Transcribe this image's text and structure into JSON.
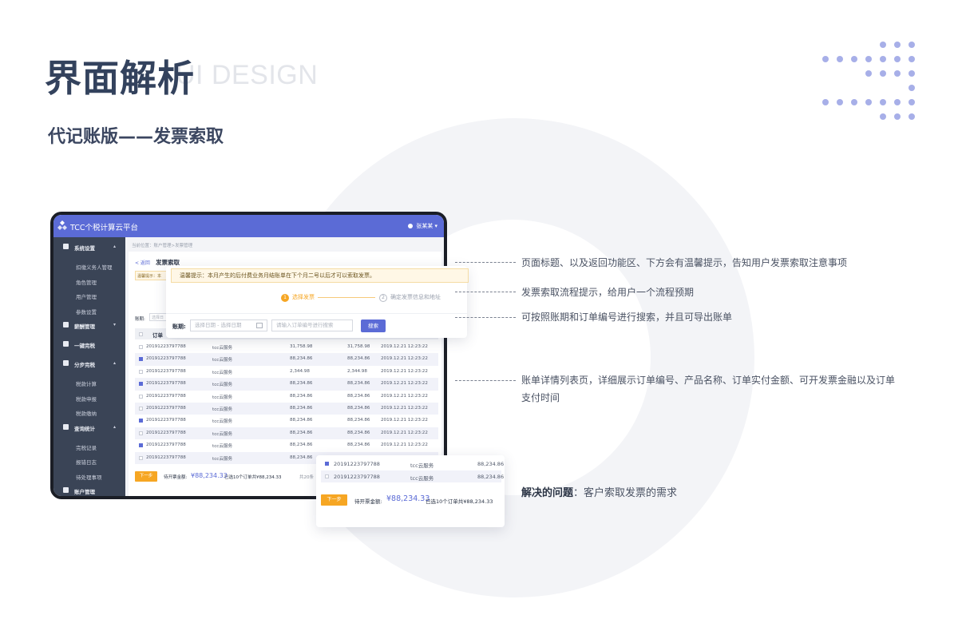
{
  "header": {
    "title": "界面解析",
    "title_bg": "UI DESIGN",
    "subtitle": "代记账版——发票索取"
  },
  "app": {
    "brand": "TCC个税计算云平台",
    "user": "张某某",
    "breadcrumb": "当前位置：账户管理>发票管理",
    "back": "< 返回",
    "page_title": "发票索取",
    "warn_short": "温馨提示：本",
    "acct_label": "账期:",
    "acct_placeholder": "选择日",
    "table_head": "订单",
    "sidebar": [
      {
        "label": "系统设置",
        "type": "group",
        "icon": "gear-icon",
        "caret": "▴"
      },
      {
        "label": "扣缴义务人管理",
        "type": "sub"
      },
      {
        "label": "角色管理",
        "type": "sub"
      },
      {
        "label": "用户管理",
        "type": "sub"
      },
      {
        "label": "参数设置",
        "type": "sub"
      },
      {
        "label": "薪酬管理",
        "type": "group",
        "icon": "wallet-icon",
        "caret": "▾"
      },
      {
        "label": "一键完税",
        "type": "group",
        "icon": "flask-icon",
        "caret": ""
      },
      {
        "label": "分步完税",
        "type": "group",
        "icon": "document-icon",
        "caret": "▴"
      },
      {
        "label": "税款计算",
        "type": "sub"
      },
      {
        "label": "税款申报",
        "type": "sub"
      },
      {
        "label": "税款缴纳",
        "type": "sub"
      },
      {
        "label": "查询统计",
        "type": "group",
        "icon": "bar-chart-icon",
        "caret": "▴"
      },
      {
        "label": "完税记录",
        "type": "sub"
      },
      {
        "label": "报错日志",
        "type": "sub"
      },
      {
        "label": "待处理事项",
        "type": "sub"
      },
      {
        "label": "账户管理",
        "type": "group",
        "icon": "user-card-icon",
        "caret": ""
      }
    ],
    "rows": [
      {
        "order": "20191223797788",
        "product": "tcc云服务",
        "paid": "31,758.98",
        "invoice": "31,758.98",
        "time": "2019.12.21 12:23:22",
        "checked": false
      },
      {
        "order": "20191223797788",
        "product": "tcc云服务",
        "paid": "88,234.86",
        "invoice": "88,234.86",
        "time": "2019.12.21 12:23:22",
        "checked": true
      },
      {
        "order": "20191223797788",
        "product": "tcc云服务",
        "paid": "2,344.98",
        "invoice": "2,344.98",
        "time": "2019.12.21 12:23:22",
        "checked": false
      },
      {
        "order": "20191223797788",
        "product": "tcc云服务",
        "paid": "88,234.86",
        "invoice": "88,234.86",
        "time": "2019.12.21 12:23:22",
        "checked": true
      },
      {
        "order": "20191223797788",
        "product": "tcc云服务",
        "paid": "88,234.86",
        "invoice": "88,234.86",
        "time": "2019.12.21 12:23:22",
        "checked": false
      },
      {
        "order": "20191223797788",
        "product": "tcc云服务",
        "paid": "88,234.86",
        "invoice": "88,234.86",
        "time": "2019.12.21 12:23:22",
        "checked": false
      },
      {
        "order": "20191223797788",
        "product": "tcc云服务",
        "paid": "88,234.86",
        "invoice": "88,234.86",
        "time": "2019.12.21 12:23:22",
        "checked": true
      },
      {
        "order": "20191223797788",
        "product": "tcc云服务",
        "paid": "88,234.86",
        "invoice": "88,234.86",
        "time": "2019.12.21 12:23:22",
        "checked": false
      },
      {
        "order": "20191223797788",
        "product": "tcc云服务",
        "paid": "88,234.86",
        "invoice": "88,234.86",
        "time": "2019.12.21 12:23:22",
        "checked": true
      },
      {
        "order": "20191223797788",
        "product": "tcc云服务",
        "paid": "88,234.86",
        "invoice": "88,234.86",
        "time": "2019.12.21 12:23:22",
        "checked": false
      }
    ],
    "footer": {
      "next": "下一步",
      "amount_label": "待开票金额:",
      "amount": "¥88,234.33",
      "note": "已选10个订单共¥88,234.33",
      "total": "共20条"
    }
  },
  "overlay1": {
    "warning": "温馨提示：本月产生的后付费业务月结账单在下个月二号以后才可以索取发票。",
    "step1_num": "1",
    "step1": "选择发票",
    "step2_num": "2",
    "step2": "确定发票信息和地址",
    "acct_label": "账期:",
    "date_range": "选择日期  -  选择日期",
    "order_placeholder": "请输入订单编号进行搜索",
    "search": "搜索"
  },
  "overlay2": {
    "rows": [
      {
        "order": "20191223797788",
        "product": "tcc云服务",
        "amount": "88,234.86",
        "checked": true
      },
      {
        "order": "20191223797788",
        "product": "tcc云服务",
        "amount": "88,234.86",
        "checked": false
      }
    ],
    "next": "下一步",
    "amount_label": "待开票金额:",
    "amount": "¥88,234.33",
    "note": "已选10个订单共¥88,234.33"
  },
  "annotations": [
    "页面标题、以及返回功能区、下方会有温馨提示，告知用户发票索取注意事项",
    "发票索取流程提示，给用户一个流程预期",
    "可按照账期和订单编号进行搜索，并且可导出账单",
    "账单详情列表页，详细展示订单编号、产品名称、订单实付金额、可开发票金融以及订单支付时间"
  ],
  "conclusion": {
    "label": "解决的问题",
    "text": "：客户索取发票的需求"
  },
  "colors": {
    "primary": "#5b6bd6",
    "accent": "#f6a623",
    "sidebar": "#3a4456",
    "dots": "#a7afe8"
  }
}
